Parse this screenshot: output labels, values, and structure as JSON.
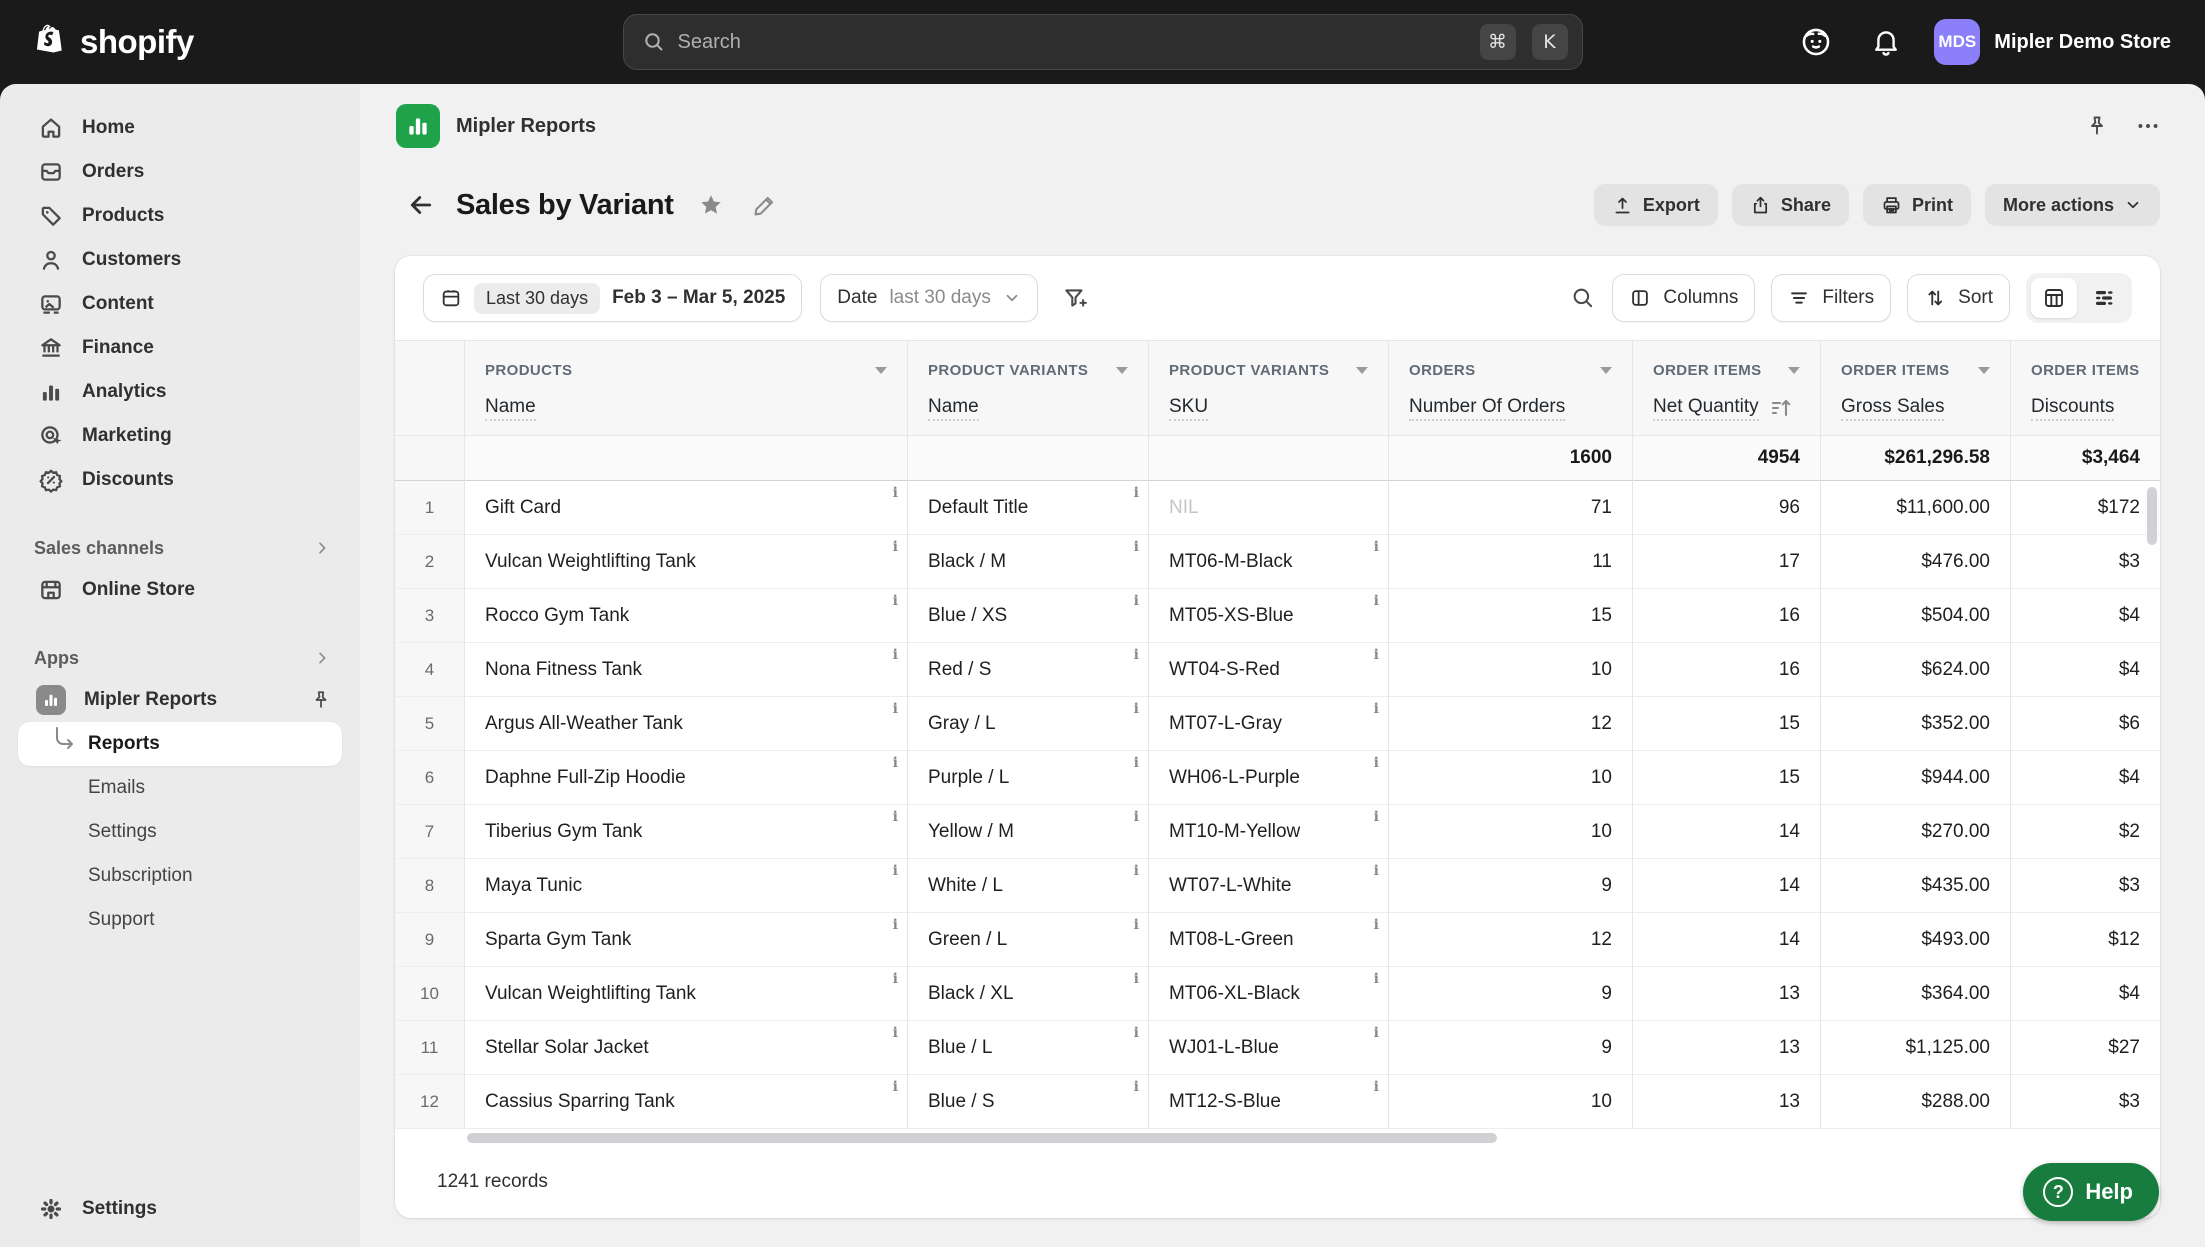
{
  "topbar": {
    "logo_text": "shopify",
    "search": {
      "placeholder": "Search",
      "shortcut_keys": [
        "⌘",
        "K"
      ]
    },
    "store": {
      "initials": "MDS",
      "name": "Mipler Demo Store"
    }
  },
  "sidebar": {
    "nav": [
      {
        "label": "Home"
      },
      {
        "label": "Orders"
      },
      {
        "label": "Products"
      },
      {
        "label": "Customers"
      },
      {
        "label": "Content"
      },
      {
        "label": "Finance"
      },
      {
        "label": "Analytics"
      },
      {
        "label": "Marketing"
      },
      {
        "label": "Discounts"
      }
    ],
    "sales_channels": {
      "label": "Sales channels",
      "items": [
        {
          "label": "Online Store"
        }
      ]
    },
    "apps": {
      "label": "Apps",
      "app": {
        "label": "Mipler Reports",
        "children": [
          {
            "label": "Reports",
            "active": true
          },
          {
            "label": "Emails"
          },
          {
            "label": "Settings"
          },
          {
            "label": "Subscription"
          },
          {
            "label": "Support"
          }
        ]
      }
    },
    "footer": {
      "label": "Settings"
    }
  },
  "app_header": {
    "title": "Mipler Reports"
  },
  "report": {
    "title": "Sales by Variant",
    "actions": {
      "export": "Export",
      "share": "Share",
      "print": "Print",
      "more": "More actions"
    }
  },
  "toolbar": {
    "date_chip": "Last 30 days",
    "date_range": "Feb 3 – Mar 5, 2025",
    "filter_field": "Date",
    "filter_value": "last 30 days",
    "columns_label": "Columns",
    "filters_label": "Filters",
    "sort_label": "Sort"
  },
  "table": {
    "columns": [
      {
        "group": "PRODUCTS",
        "field": "Name"
      },
      {
        "group": "PRODUCT VARIANTS",
        "field": "Name"
      },
      {
        "group": "PRODUCT VARIANTS",
        "field": "SKU"
      },
      {
        "group": "ORDERS",
        "field": "Number Of Orders"
      },
      {
        "group": "ORDER ITEMS",
        "field": "Net Quantity"
      },
      {
        "group": "ORDER ITEMS",
        "field": "Gross Sales"
      },
      {
        "group": "ORDER ITEMS",
        "field": "Discounts"
      }
    ],
    "totals": {
      "orders": "1600",
      "net_quantity": "4954",
      "gross_sales": "$261,296.58",
      "discounts": "$3,464"
    },
    "rows": [
      {
        "num": "1",
        "product": "Gift Card",
        "variant": "Default Title",
        "sku": "NIL",
        "orders": "71",
        "net_quantity": "96",
        "gross_sales": "$11,600.00",
        "discounts": "$172"
      },
      {
        "num": "2",
        "product": "Vulcan Weightlifting Tank",
        "variant": "Black / M",
        "sku": "MT06-M-Black",
        "orders": "11",
        "net_quantity": "17",
        "gross_sales": "$476.00",
        "discounts": "$3"
      },
      {
        "num": "3",
        "product": "Rocco Gym Tank",
        "variant": "Blue / XS",
        "sku": "MT05-XS-Blue",
        "orders": "15",
        "net_quantity": "16",
        "gross_sales": "$504.00",
        "discounts": "$4"
      },
      {
        "num": "4",
        "product": "Nona Fitness Tank",
        "variant": "Red / S",
        "sku": "WT04-S-Red",
        "orders": "10",
        "net_quantity": "16",
        "gross_sales": "$624.00",
        "discounts": "$4"
      },
      {
        "num": "5",
        "product": "Argus All-Weather Tank",
        "variant": "Gray / L",
        "sku": "MT07-L-Gray",
        "orders": "12",
        "net_quantity": "15",
        "gross_sales": "$352.00",
        "discounts": "$6"
      },
      {
        "num": "6",
        "product": "Daphne Full-Zip Hoodie",
        "variant": "Purple / L",
        "sku": "WH06-L-Purple",
        "orders": "10",
        "net_quantity": "15",
        "gross_sales": "$944.00",
        "discounts": "$4"
      },
      {
        "num": "7",
        "product": "Tiberius Gym Tank",
        "variant": "Yellow / M",
        "sku": "MT10-M-Yellow",
        "orders": "10",
        "net_quantity": "14",
        "gross_sales": "$270.00",
        "discounts": "$2"
      },
      {
        "num": "8",
        "product": "Maya Tunic",
        "variant": "White / L",
        "sku": "WT07-L-White",
        "orders": "9",
        "net_quantity": "14",
        "gross_sales": "$435.00",
        "discounts": "$3"
      },
      {
        "num": "9",
        "product": "Sparta Gym Tank",
        "variant": "Green / L",
        "sku": "MT08-L-Green",
        "orders": "12",
        "net_quantity": "14",
        "gross_sales": "$493.00",
        "discounts": "$12"
      },
      {
        "num": "10",
        "product": "Vulcan Weightlifting Tank",
        "variant": "Black / XL",
        "sku": "MT06-XL-Black",
        "orders": "9",
        "net_quantity": "13",
        "gross_sales": "$364.00",
        "discounts": "$4"
      },
      {
        "num": "11",
        "product": "Stellar Solar Jacket",
        "variant": "Blue / L",
        "sku": "WJ01-L-Blue",
        "orders": "9",
        "net_quantity": "13",
        "gross_sales": "$1,125.00",
        "discounts": "$27"
      },
      {
        "num": "12",
        "product": "Cassius Sparring Tank",
        "variant": "Blue / S",
        "sku": "MT12-S-Blue",
        "orders": "10",
        "net_quantity": "13",
        "gross_sales": "$288.00",
        "discounts": "$3"
      }
    ]
  },
  "footer": {
    "records": "1241 records"
  },
  "help": {
    "label": "Help"
  },
  "colors": {
    "topbar": "#1a1a1a",
    "brand_green": "#1fa24a",
    "help_green": "#177c3d",
    "avatar_purple": "#8b80f9"
  }
}
